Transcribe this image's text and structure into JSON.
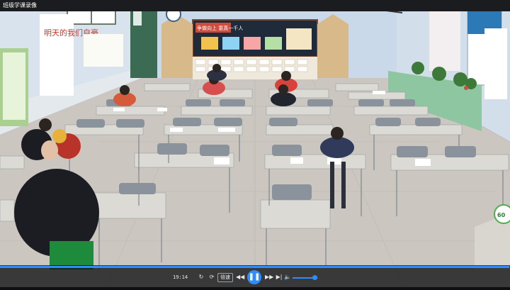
{
  "window": {
    "title": "班级学课录像"
  },
  "player": {
    "time": "19:14",
    "speed_label": "倍速",
    "progress": 0.999,
    "volume": 0.85,
    "icons": {
      "loop": "loop-icon",
      "refresh": "refresh-icon",
      "rewind": "rewind-icon",
      "play_pause": "pause-icon",
      "forward": "fast-forward-icon",
      "next": "next-icon",
      "volume": "volume-icon"
    }
  },
  "badge": {
    "value": "60"
  },
  "scene": {
    "wall_banner": "争做向上 童真一千人",
    "slogan_left": "明天的我们自豪"
  },
  "colors": {
    "accent": "#2f8cff",
    "wall": "#c9d9ea",
    "floor": "#cbc6bf",
    "desk_top": "#dcdad4",
    "chair": "#8a929c",
    "badge_ring": "#4caf50"
  }
}
